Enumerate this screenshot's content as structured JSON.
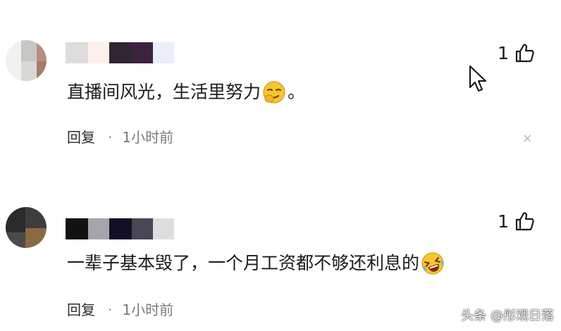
{
  "comments": [
    {
      "text": "直播间风光，生活里努力",
      "tail": "。",
      "emoji": "smirk-emoji",
      "like_count": "1",
      "reply_label": "回复",
      "separator": "·",
      "time": "1小时前"
    },
    {
      "text": "一辈子基本毁了，一个月工资都不够还利息的",
      "tail": "",
      "emoji": "laugh-cry-emoji",
      "like_count": "1",
      "reply_label": "回复",
      "separator": "·",
      "time": "1小时前"
    }
  ],
  "close_glyph": "×",
  "watermark": "头条 @彤观日落",
  "colors": {
    "text": "#1b1b1b",
    "meta": "#7a7a7a",
    "emoji": "#f6c531"
  }
}
